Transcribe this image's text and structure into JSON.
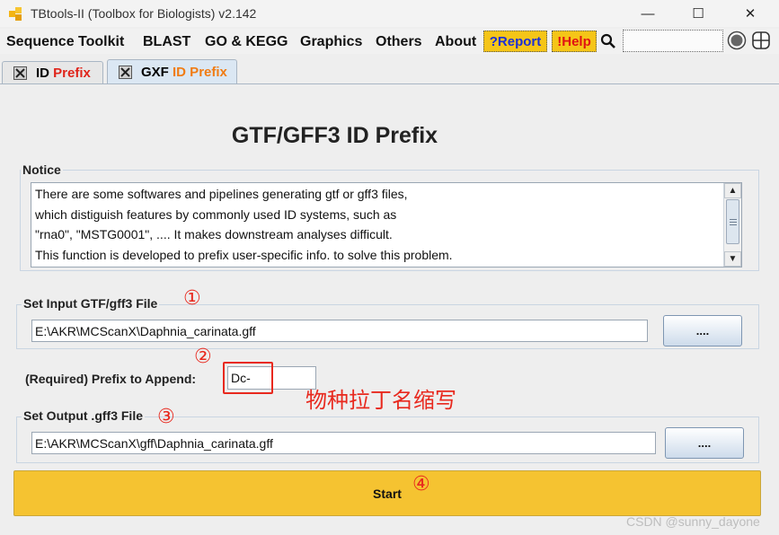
{
  "window": {
    "title": "TBtools-II (Toolbox for Biologists) v2.142",
    "controls": {
      "minimize": "—",
      "maximize": "☐",
      "close": "✕"
    }
  },
  "menu": {
    "items": [
      "Sequence Toolkit",
      "BLAST",
      "GO & KEGG",
      "Graphics",
      "Others",
      "About"
    ],
    "report": "?Report",
    "help": "!Help",
    "search_placeholder": ""
  },
  "tabs": [
    {
      "prefix": "ID ",
      "accent": "Prefix",
      "accent_color": "#e0241a"
    },
    {
      "prefix": "GXF ",
      "accent": "ID Prefix",
      "accent_color": "#f07c14"
    }
  ],
  "page": {
    "title": "GTF/GFF3 ID Prefix",
    "notice": {
      "label": "Notice",
      "lines": [
        "There are some softwares and pipelines generating gtf or gff3 files,",
        "which distiguish features by commonly used ID systems, such as",
        "\"rna0\", \"MSTG0001\", .... It makes downstream analyses difficult.",
        "This function is developed to prefix user-specific info. to solve this problem."
      ]
    },
    "input_file": {
      "label": "Set Input GTF/gff3 File",
      "value": "E:\\AKR\\MCScanX\\Daphnia_carinata.gff",
      "browse": "...."
    },
    "prefix": {
      "label": "(Required) Prefix to Append:",
      "value": "Dc-"
    },
    "output_file": {
      "label": "Set Output .gff3 File",
      "value": "E:\\AKR\\MCScanX\\gff\\Daphnia_carinata.gff",
      "browse": "...."
    },
    "start": "Start"
  },
  "annotations": {
    "markers": [
      "①",
      "②",
      "③",
      "④"
    ],
    "prefix_note": "物种拉丁名缩写",
    "color": "#e8291e"
  },
  "watermark": "CSDN @sunny_dayone",
  "colors": {
    "start_button": "#f5c331",
    "badge": "#f5c518"
  }
}
